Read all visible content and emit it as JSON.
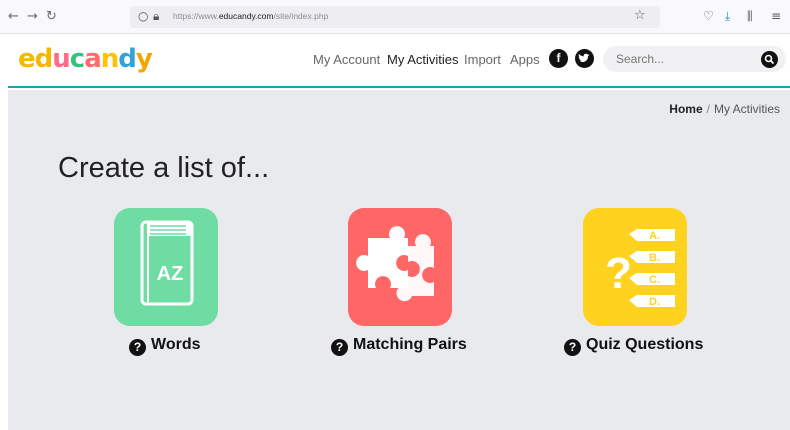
{
  "browser": {
    "back_icon": "back-arrow-icon",
    "forward_icon": "forward-arrow-icon",
    "reload_icon": "reload-icon",
    "url_prefix": "https://www.",
    "url_domain": "educandy.com",
    "url_path": "/site/index.php"
  },
  "header": {
    "logo_letters": [
      "e",
      "d",
      "u",
      "c",
      "a",
      "n",
      "d",
      "y"
    ],
    "logo_colors": [
      "#f5b800",
      "#f5b800",
      "#ff6b8a",
      "#35c27b",
      "#ff6b6b",
      "#ffc400",
      "#2fa4d9",
      "#f5a400"
    ],
    "nav": {
      "account": "My Account",
      "activities": "My Activities",
      "import": "Import",
      "apps": "Apps"
    },
    "facebook": "f",
    "search_placeholder": "Search..."
  },
  "breadcrumb": {
    "home": "Home",
    "separator": "/",
    "current": "My Activities"
  },
  "main": {
    "heading": "Create a list of...",
    "tiles": [
      {
        "label": "Words",
        "color": "#6fdca4",
        "icon": "book-az-icon"
      },
      {
        "label": "Matching Pairs",
        "color": "#ff6767",
        "icon": "puzzle-icon"
      },
      {
        "label": "Quiz Questions",
        "color": "#ffd21f",
        "icon": "quiz-abcd-icon"
      }
    ],
    "book_text": "AZ",
    "quiz_options": [
      "A.",
      "B.",
      "C.",
      "D."
    ]
  }
}
